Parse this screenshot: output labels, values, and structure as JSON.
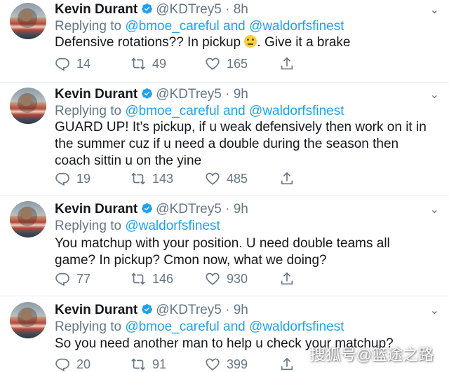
{
  "tweets": [
    {
      "name": "Kevin Durant",
      "handle": "@KDTrey5",
      "dot": "·",
      "time": "8h",
      "replying_prefix": "Replying to",
      "replying_user1": "@bmoe_careful",
      "replying_and": "and",
      "replying_user2": "@waldorfsfinest",
      "text_before": "Defensive rotations?? In pickup ",
      "emoji": "neutral-face",
      "text_after": ". Give it a brake",
      "replies": "14",
      "retweets": "49",
      "likes": "165"
    },
    {
      "name": "Kevin Durant",
      "handle": "@KDTrey5",
      "dot": "·",
      "time": "9h",
      "replying_prefix": "Replying to",
      "replying_user1": "@bmoe_careful",
      "replying_and": "and",
      "replying_user2": "@waldorfsfinest",
      "text": "GUARD UP! It’s pickup, if u weak defensively then work on it in the summer cuz if u need a double during the season then coach sittin u on the yine",
      "replies": "19",
      "retweets": "143",
      "likes": "485"
    },
    {
      "name": "Kevin Durant",
      "handle": "@KDTrey5",
      "dot": "·",
      "time": "9h",
      "replying_prefix": "Replying to",
      "replying_user1": "@waldorfsfinest",
      "text": "You matchup with your position. U need double teams all game? In pickup? Cmon now, what we doing?",
      "replies": "77",
      "retweets": "146",
      "likes": "930"
    },
    {
      "name": "Kevin Durant",
      "handle": "@KDTrey5",
      "dot": "·",
      "time": "9h",
      "replying_prefix": "Replying to",
      "replying_user1": "@bmoe_careful",
      "replying_and": "and",
      "replying_user2": "@waldorfsfinest",
      "text": "So you need another man to help u check your matchup?",
      "replies": "20",
      "retweets": "91",
      "likes": "399"
    }
  ],
  "caret": "⌄",
  "watermark": "搜狐号@篮途之路",
  "colors": {
    "link": "#1da1f2",
    "muted": "#657786",
    "text": "#14171a",
    "verified": "#1da1f2"
  }
}
